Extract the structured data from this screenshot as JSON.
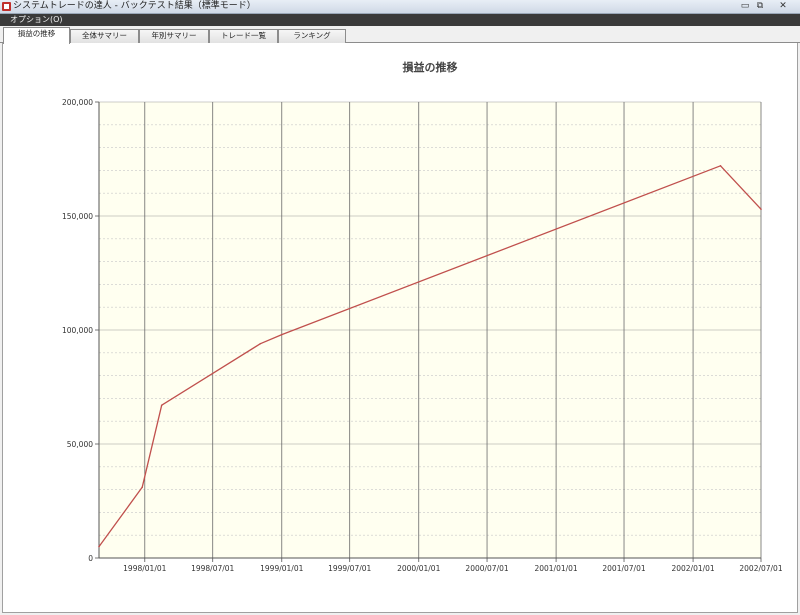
{
  "window": {
    "title": "システムトレードの達人 - バックテスト結果（標準モード）",
    "minimize": "▭",
    "maximize": "⧉",
    "close": "✕"
  },
  "menu": {
    "options": "オプション(O)"
  },
  "tabs": [
    {
      "label": "損益の推移",
      "active": true
    },
    {
      "label": "全体サマリー",
      "active": false
    },
    {
      "label": "年別サマリー",
      "active": false
    },
    {
      "label": "トレード一覧",
      "active": false
    },
    {
      "label": "ランキング",
      "active": false
    }
  ],
  "colors": {
    "plot_background": "#fffff0",
    "line": "#c0504d",
    "grid": "#808080"
  },
  "chart_data": {
    "type": "line",
    "title": "損益の推移",
    "xlabel": "",
    "ylabel": "",
    "x_ticks": [
      "1998/01/01",
      "1998/07/01",
      "1999/01/01",
      "1999/07/01",
      "2000/01/01",
      "2000/07/01",
      "2001/01/01",
      "2001/07/01",
      "2002/01/01",
      "2002/07/01"
    ],
    "y_ticks": [
      "0",
      "50,000",
      "100,000",
      "150,000",
      "200,000"
    ],
    "xlim": [
      "1997/09/01",
      "2002/07/01"
    ],
    "ylim": [
      0,
      200000
    ],
    "grid": true,
    "series": [
      {
        "x": [
          "1997/09/01",
          "1997/12/25",
          "1998/02/15",
          "1998/11/05",
          "1999/01/01",
          "2002/03/15",
          "2002/07/01"
        ],
        "y": [
          5000,
          31000,
          67000,
          94000,
          98000,
          172000,
          153000
        ]
      }
    ]
  }
}
